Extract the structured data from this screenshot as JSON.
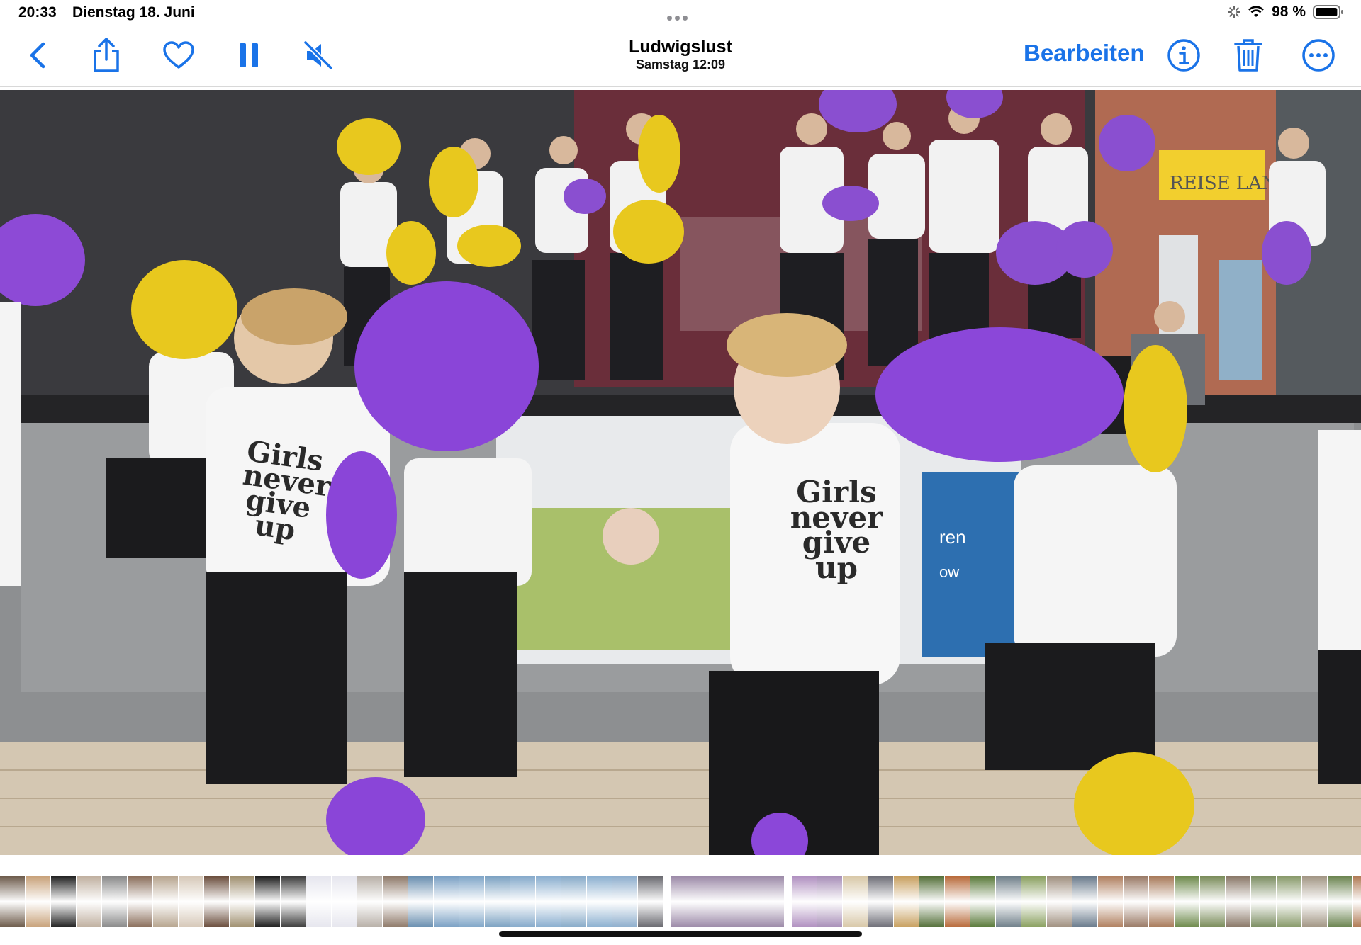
{
  "status_bar": {
    "time": "20:33",
    "date": "Dienstag 18. Juni",
    "battery_pct": "98 %",
    "battery_level": 0.98,
    "icons": [
      "activity-spinner-icon",
      "wifi-icon",
      "battery-icon"
    ]
  },
  "toolbar": {
    "title": "Ludwigslust",
    "subtitle": "Samstag  12:09",
    "edit_label": "Bearbeiten",
    "icons": [
      "back-chevron-icon",
      "share-icon",
      "heart-icon",
      "pause-icon",
      "speaker-muted-icon",
      "info-icon",
      "trash-icon",
      "more-icon"
    ],
    "accent_color": "#1a73e8"
  },
  "photo": {
    "shirt_text_left": "Girls never give up",
    "shirt_text_center": "Girls never give up",
    "shop_sign": "REISE LAND",
    "banner_text_1": "ren",
    "banner_text_2": "ow"
  },
  "filmstrip": {
    "thumb_colors": [
      "#6d5b4b",
      "#c8a27a",
      "#222222",
      "#c0b0a0",
      "#8a8a8a",
      "#8b6f5c",
      "#b7a58f",
      "#d6c8b8",
      "#6b4e3d",
      "#a09070",
      "#1e1e1e",
      "#3d3d3d",
      "#e6e6ee",
      "#e6e6ee",
      "#b8b0a8",
      "#8f7a6a",
      "#6a8fb0",
      "#7aa0c4",
      "#80a6c8",
      "#7ca2c2",
      "#86aacb",
      "#8aaecf",
      "#88abc9",
      "#8cb0d0",
      "#8eaecd",
      "#6a6a70",
      "#9c8aa8",
      "#b090c0",
      "#a88fb8",
      "#d8c8a8",
      "#6f6f78",
      "#c8a060",
      "#55703a",
      "#b86a3a",
      "#5a7a3a",
      "#70808a",
      "#8aa060",
      "#a09080",
      "#6a7b8c",
      "#b08060",
      "#9a7a66",
      "#a87a5a",
      "#6e8a4c",
      "#7a8c5a",
      "#8a7868",
      "#7c8e62",
      "#889a6a",
      "#a29684",
      "#6b8450",
      "#b07a54",
      "#7e9c60",
      "#8a6a58",
      "#7a9060",
      "#9ab0c8",
      "#5a7aa0",
      "#6a8ab0"
    ],
    "selected_index": 26
  }
}
